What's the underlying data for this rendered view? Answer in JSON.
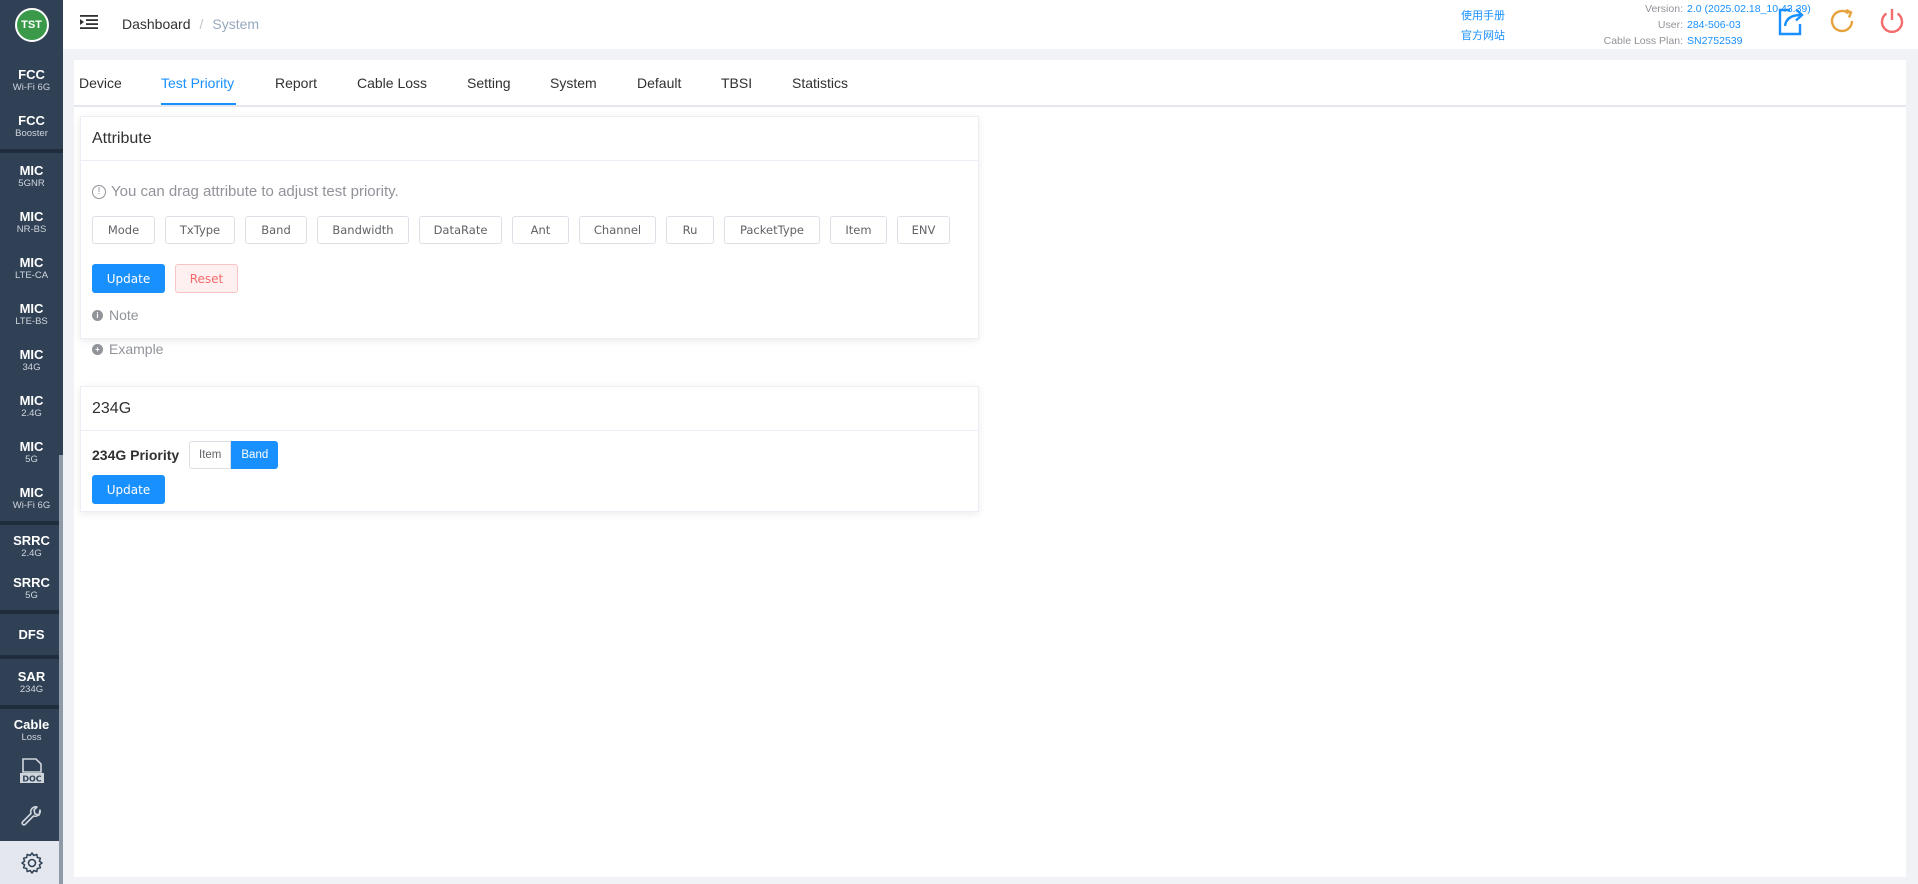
{
  "logo": {
    "text": "TST"
  },
  "sidebar": {
    "items": [
      {
        "big": "FCC",
        "small": "Wi-Fi 6G"
      },
      {
        "big": "FCC",
        "small": "Booster"
      },
      {
        "big": "MIC",
        "small": "5GNR"
      },
      {
        "big": "MIC",
        "small": "NR-BS"
      },
      {
        "big": "MIC",
        "small": "LTE-CA"
      },
      {
        "big": "MIC",
        "small": "LTE-BS"
      },
      {
        "big": "MIC",
        "small": "34G"
      },
      {
        "big": "MIC",
        "small": "2.4G"
      },
      {
        "big": "MIC",
        "small": "5G"
      },
      {
        "big": "MIC",
        "small": "Wi-Fi 6G"
      },
      {
        "big": "SRRC",
        "small": "2.4G"
      },
      {
        "big": "SRRC",
        "small": "5G"
      },
      {
        "big": "DFS",
        "small": ""
      },
      {
        "big": "SAR",
        "small": "234G"
      },
      {
        "big": "Cable",
        "small": "Loss"
      }
    ],
    "doc_icon_label": "DOC"
  },
  "header": {
    "breadcrumb_home": "Dashboard",
    "breadcrumb_sep": "/",
    "breadcrumb_current": "System",
    "manual_link": "使用手册",
    "website_link": "官方网站",
    "version_label": "Version:",
    "version_value": "2.0 (2025.02.18_10.43.39)",
    "user_label": "User:",
    "user_value": "284-506-03",
    "plan_label": "Cable Loss Plan:",
    "plan_value": "SN2752539"
  },
  "tabs": [
    "Device",
    "Test Priority",
    "Report",
    "Cable Loss",
    "Setting",
    "System",
    "Default",
    "TBSI",
    "Statistics"
  ],
  "attribute_card": {
    "title": "Attribute",
    "hint": "You can drag attribute to adjust test priority.",
    "attributes": [
      "Mode",
      "TxType",
      "Band",
      "Bandwidth",
      "DataRate",
      "Ant",
      "Channel",
      "Ru",
      "PacketType",
      "Item",
      "ENV"
    ],
    "update_label": "Update",
    "reset_label": "Reset",
    "note_label": "Note",
    "example_label": "Example"
  },
  "priority_card": {
    "title": "234G",
    "priority_label": "234G Priority",
    "options": [
      "Item",
      "Band"
    ],
    "selected": "Band",
    "update_label": "Update"
  },
  "colors": {
    "primary": "#1890ff",
    "sidebar": "#304156",
    "danger": "#f56c6c",
    "warning": "#e6a23c"
  }
}
